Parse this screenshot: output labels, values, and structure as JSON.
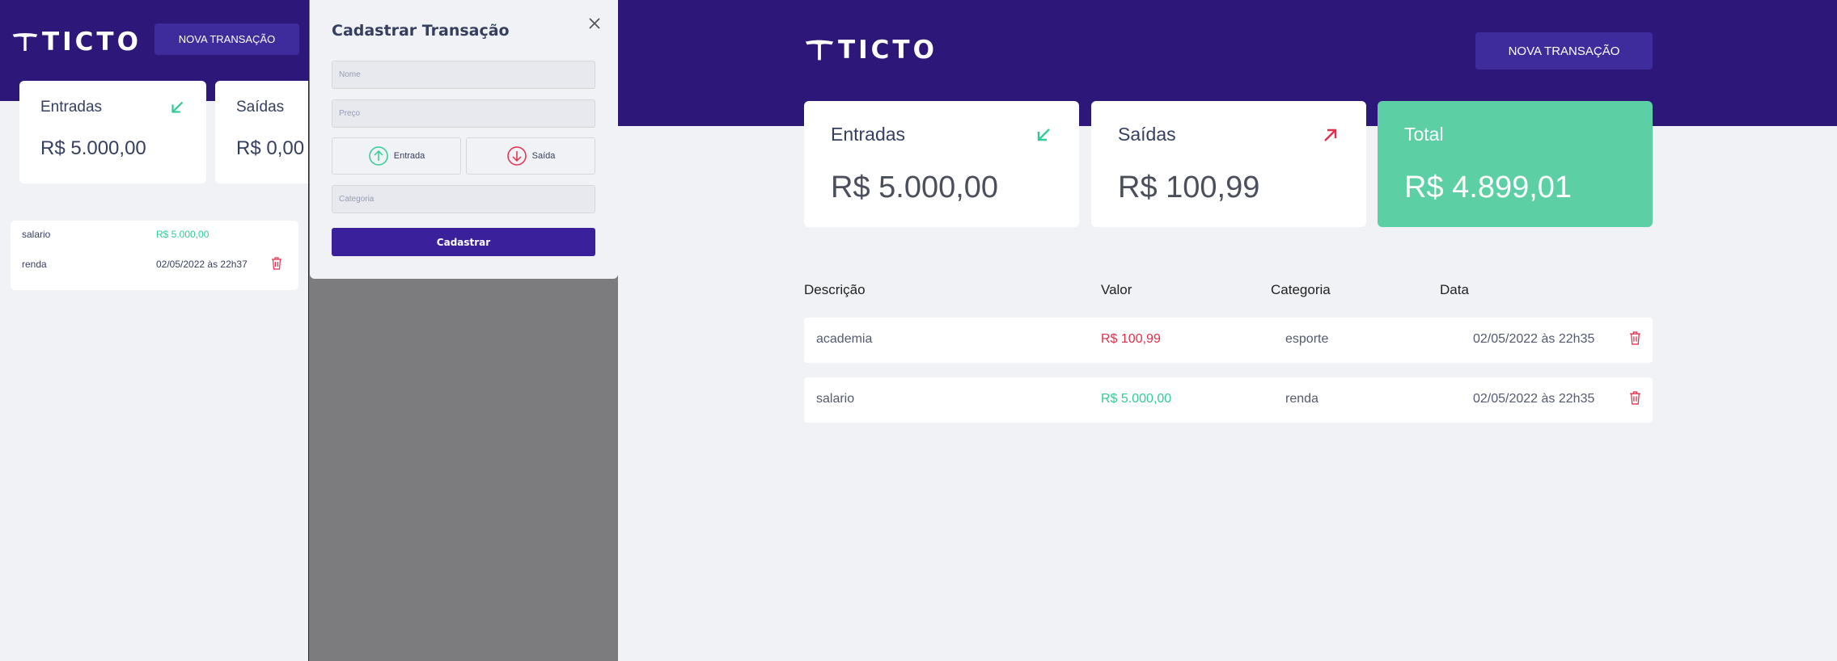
{
  "brand": {
    "name": "TICTO"
  },
  "colors": {
    "header": "#2d1879",
    "income": "#33cc95",
    "outcome": "#e52e4d",
    "total": "#5ccfa4"
  },
  "mobile": {
    "new_button": "NOVA TRANSAÇÃO",
    "cards": [
      {
        "label": "Entradas",
        "value": "R$ 5.000,00",
        "icon": "arrow-down-left-icon"
      },
      {
        "label": "Saídas",
        "value": "R$ 0,00",
        "icon": "arrow-up-right-icon"
      }
    ],
    "rows": [
      {
        "title": "salario",
        "value": "R$ 5.000,00"
      },
      {
        "title": "renda",
        "value": "02/05/2022 às 22h37"
      }
    ]
  },
  "modal": {
    "title": "Cadastrar Transação",
    "name_placeholder": "Nome",
    "price_placeholder": "Preço",
    "income_label": "Entrada",
    "outcome_label": "Saída",
    "category_placeholder": "Categoria",
    "submit_label": "Cadastrar"
  },
  "desktop": {
    "new_button": "NOVA TRANSAÇÃO",
    "cards": [
      {
        "label": "Entradas",
        "value": "R$ 5.000,00",
        "icon": "arrow-down-left-icon"
      },
      {
        "label": "Saídas",
        "value": "R$ 100,99",
        "icon": "arrow-up-right-icon"
      },
      {
        "label": "Total",
        "value": "R$ 4.899,01"
      }
    ],
    "table": {
      "headers": [
        "Descrição",
        "Valor",
        "Categoria",
        "Data"
      ],
      "rows": [
        {
          "title": "academia",
          "amount": "R$ 100,99",
          "type": "outcome",
          "category": "esporte",
          "date": "02/05/2022 às 22h35"
        },
        {
          "title": "salario",
          "amount": "R$ 5.000,00",
          "type": "income",
          "category": "renda",
          "date": "02/05/2022 às 22h35"
        }
      ]
    }
  }
}
